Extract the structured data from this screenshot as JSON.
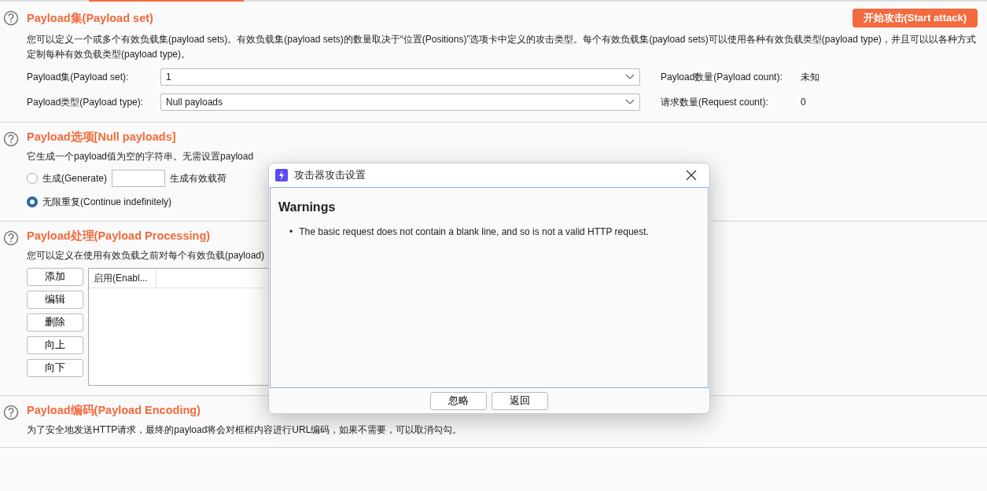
{
  "payload_set_section": {
    "title": "Payload集(Payload set)",
    "start_button": "开始攻击(Start attack)",
    "description": "您可以定义一个或多个有效负载集(payload sets)。有效负载集(payload sets)的数量取决于“位置(Positions)”选项卡中定义的攻击类型。每个有效负载集(payload sets)可以使用各种有效负载类型(payload type)，并且可以以各种方式定制每种有效负载类型(payload type)。",
    "fields": [
      {
        "label": "Payload集(Payload set):",
        "value": "1",
        "stat_label": "Payload数量(Payload count):",
        "stat_value": "未知"
      },
      {
        "label": "Payload类型(Payload type):",
        "value": "Null payloads",
        "stat_label": "请求数量(Request count):",
        "stat_value": "0"
      }
    ]
  },
  "payload_options_section": {
    "title": "Payload选项[Null payloads]",
    "description": "它生成一个payload值为空的字符串。无需设置payload",
    "options": [
      {
        "label": "生成(Generate)",
        "selected": false,
        "suffix": "生成有效载荷"
      },
      {
        "label": "无限重复(Continue indefinitely)",
        "selected": true
      }
    ]
  },
  "payload_processing_section": {
    "title": "Payload处理(Payload Processing)",
    "description": "您可以定义在使用有效负载之前对每个有效负载(payload)",
    "buttons": [
      "添加",
      "编辑",
      "删除",
      "向上",
      "向下"
    ],
    "table": {
      "columns": [
        "启用(Enabl..."
      ]
    }
  },
  "payload_encoding_section": {
    "title": "Payload编码(Payload Encoding)",
    "description": "为了安全地发送HTTP请求，最终的payload将会对框框内容进行URL编码，如果不需要，可以取消勾勾。"
  },
  "dialog": {
    "title": "攻击器攻击设置",
    "heading": "Warnings",
    "bullet": "•",
    "warnings": [
      "The basic request does not contain a blank line, and so is not a valid HTTP request."
    ],
    "buttons": [
      "忽略",
      "返回"
    ]
  }
}
